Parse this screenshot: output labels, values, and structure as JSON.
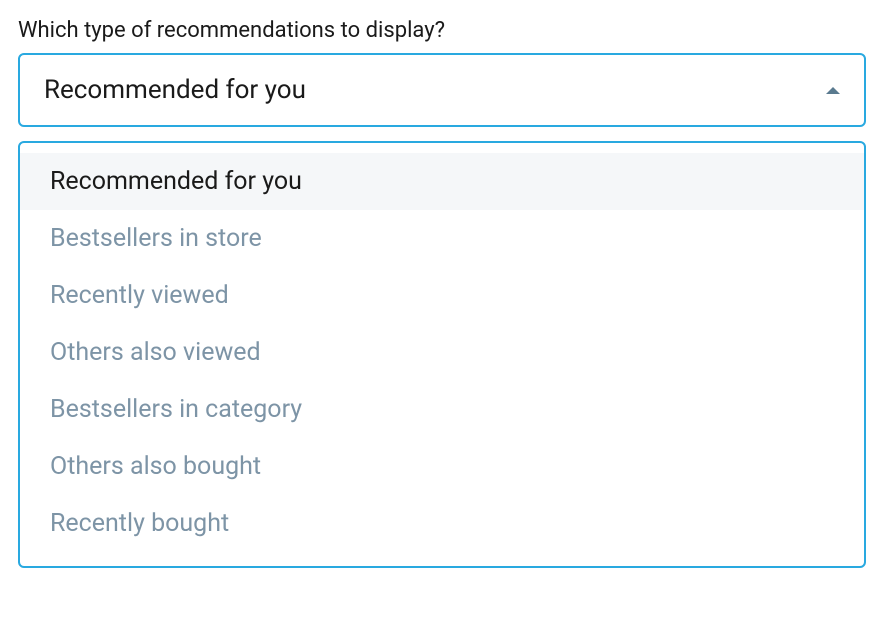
{
  "field": {
    "label": "Which type of recommendations to display?",
    "selected_value": "Recommended for you"
  },
  "dropdown": {
    "options": [
      {
        "label": "Recommended for you",
        "selected": true
      },
      {
        "label": "Bestsellers in store",
        "selected": false
      },
      {
        "label": "Recently viewed",
        "selected": false
      },
      {
        "label": "Others also viewed",
        "selected": false
      },
      {
        "label": "Bestsellers in category",
        "selected": false
      },
      {
        "label": "Others also bought",
        "selected": false
      },
      {
        "label": "Recently bought",
        "selected": false
      }
    ]
  },
  "colors": {
    "accent": "#29a9e0",
    "text_primary": "#1a1a1a",
    "text_muted": "#7d94a6",
    "option_selected_bg": "#f5f7f9"
  }
}
